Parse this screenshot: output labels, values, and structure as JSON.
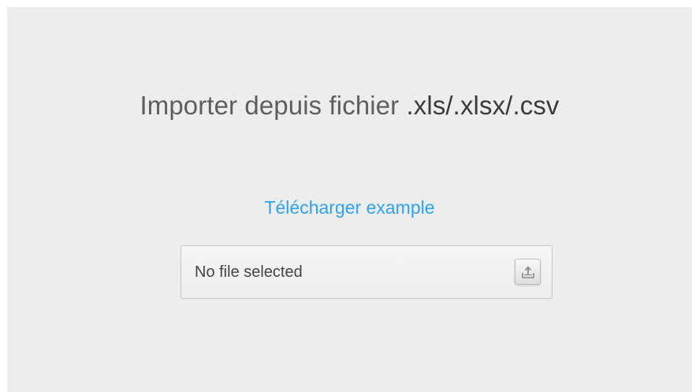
{
  "header": {
    "title_text": "Importer depuis fichier ",
    "title_ext": ".xls/.xlsx/.csv"
  },
  "download": {
    "label": "Télécharger example"
  },
  "file_input": {
    "status": "No file selected",
    "button_icon": "upload-icon"
  },
  "colors": {
    "panel_bg": "#ededed",
    "link": "#2ea3f2",
    "title": "#5e5e5e"
  }
}
